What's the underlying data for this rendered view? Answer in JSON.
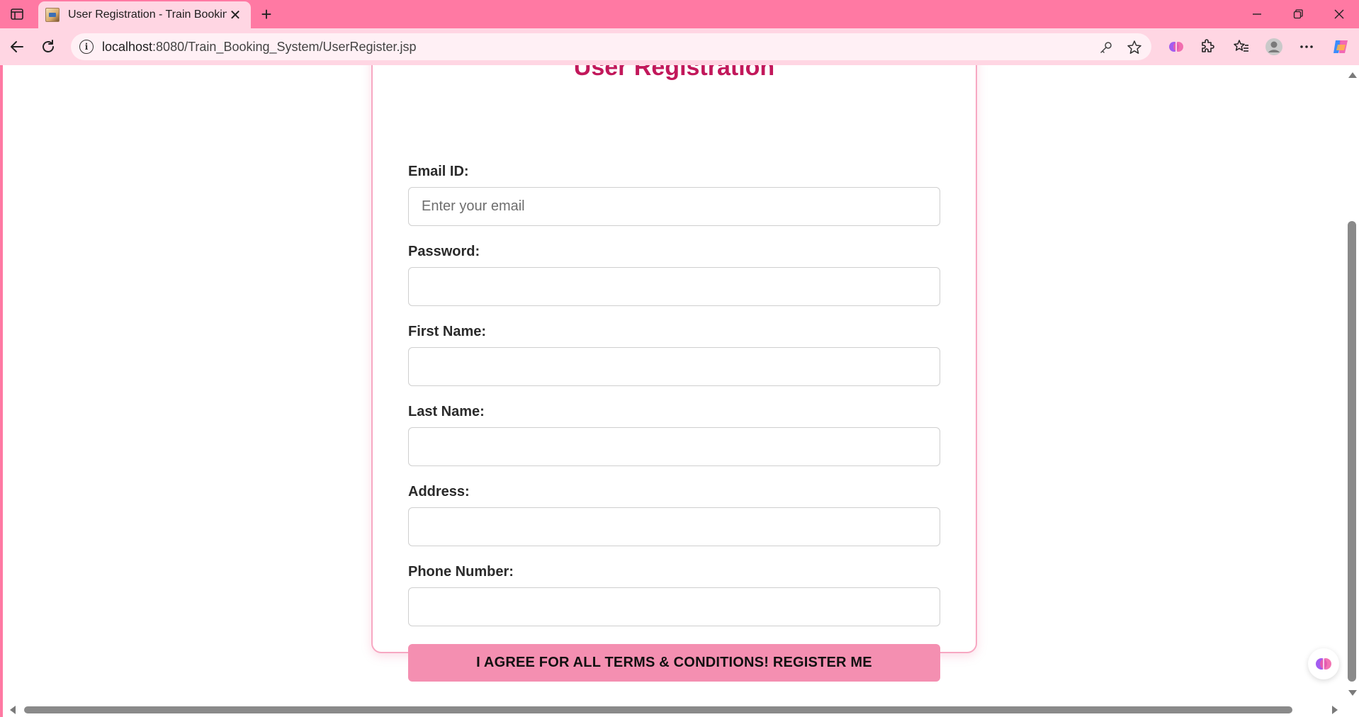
{
  "browser": {
    "tab": {
      "title": "User Registration - Train Booking",
      "close_glyph": "✕"
    },
    "new_tab_glyph": "+",
    "address": {
      "host": "localhost",
      "path": ":8080/Train_Booking_System/UserRegister.jsp"
    },
    "window_controls": {
      "minimize": "—",
      "maximize": "❐",
      "close": "✕"
    },
    "colors": {
      "chrome": "#ff79a3",
      "toolbar": "#ffd6e3"
    }
  },
  "page": {
    "title": "User Registration",
    "fields": [
      {
        "label": "Email ID:",
        "placeholder": "Enter your email",
        "value": ""
      },
      {
        "label": "Password:",
        "placeholder": "",
        "value": ""
      },
      {
        "label": "First Name:",
        "placeholder": "",
        "value": ""
      },
      {
        "label": "Last Name:",
        "placeholder": "",
        "value": ""
      },
      {
        "label": "Address:",
        "placeholder": "",
        "value": ""
      },
      {
        "label": "Phone Number:",
        "placeholder": "",
        "value": ""
      }
    ],
    "submit_label": "I AGREE FOR ALL TERMS & CONDITIONS! REGISTER ME",
    "colors": {
      "accent": "#f48fb1",
      "title": "#c2185b",
      "card_border": "#f7a8c2"
    }
  }
}
